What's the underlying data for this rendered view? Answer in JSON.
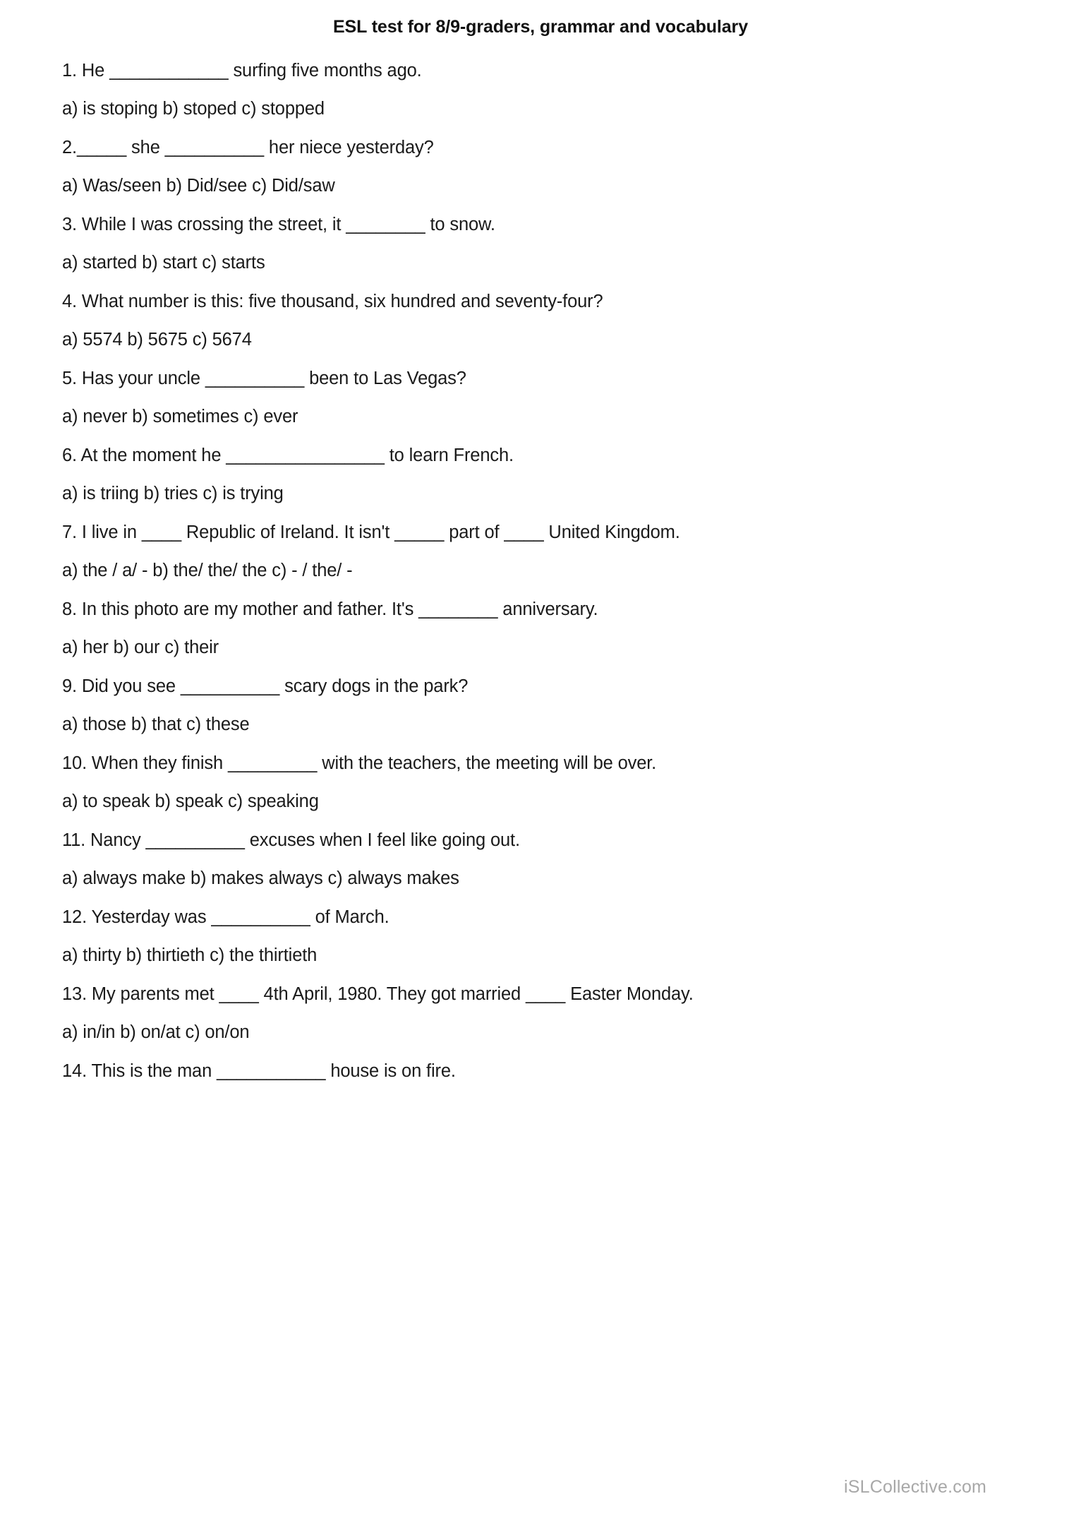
{
  "document": {
    "title": "ESL test for 8/9-graders, grammar and vocabulary",
    "watermark": "iSLCollective.com"
  },
  "questions": [
    {
      "number": "1.",
      "text": "1. He ____________ surfing five months ago.",
      "options_text": "a) is stoping          b) stoped          c) stopped",
      "options": [
        {
          "label": "a)",
          "value": "is stoping"
        },
        {
          "label": "b)",
          "value": "stoped"
        },
        {
          "label": "c)",
          "value": "stopped"
        }
      ]
    },
    {
      "number": "2.",
      "text": "2._____ she __________ her niece yesterday?",
      "options_text": "a) Was/seen          b) Did/see          c) Did/saw",
      "options": [
        {
          "label": "a)",
          "value": "Was/seen"
        },
        {
          "label": "b)",
          "value": "Did/see"
        },
        {
          "label": "c)",
          "value": "Did/saw"
        }
      ]
    },
    {
      "number": "3.",
      "text": "3. While I was crossing the street, it ________ to snow.",
      "options_text": "a) started          b) start          c) starts",
      "options": [
        {
          "label": "a)",
          "value": "started"
        },
        {
          "label": "b)",
          "value": "start"
        },
        {
          "label": "c)",
          "value": "starts"
        }
      ]
    },
    {
      "number": "4.",
      "text": "4. What number is this: five thousand, six hundred and seventy-four?",
      "options_text": "a) 5574          b) 5675          c) 5674",
      "options": [
        {
          "label": "a)",
          "value": "5574"
        },
        {
          "label": "b)",
          "value": "5675"
        },
        {
          "label": "c)",
          "value": "5674"
        }
      ]
    },
    {
      "number": "5.",
      "text": "5. Has your uncle __________ been to Las Vegas?",
      "options_text": "a) never          b) sometimes          c) ever",
      "options": [
        {
          "label": "a)",
          "value": "never"
        },
        {
          "label": "b)",
          "value": "sometimes"
        },
        {
          "label": "c)",
          "value": "ever"
        }
      ]
    },
    {
      "number": "6.",
      "text": "6. At the moment he ________________ to learn French.",
      "options_text": "a) is triing          b) tries          c) is trying",
      "options": [
        {
          "label": "a)",
          "value": "is triing"
        },
        {
          "label": "b)",
          "value": "tries"
        },
        {
          "label": "c)",
          "value": "is trying"
        }
      ]
    },
    {
      "number": "7.",
      "text": "7. I live in ____ Republic of Ireland. It isn't _____ part of ____ United Kingdom.",
      "options_text": "a)  the / a/ -          b) the/ the/ the     c) - / the/ -",
      "options": [
        {
          "label": "a)",
          "value": " the / a/ -"
        },
        {
          "label": "b)",
          "value": "the/ the/ the"
        },
        {
          "label": "c)",
          "value": "- / the/ -"
        }
      ]
    },
    {
      "number": "8.",
      "text": "8. In this photo are my mother and father. It's ________ anniversary.",
      "options_text": "a) her          b) our          c) their",
      "options": [
        {
          "label": "a)",
          "value": "her"
        },
        {
          "label": "b)",
          "value": "our"
        },
        {
          "label": "c)",
          "value": "their"
        }
      ]
    },
    {
      "number": "9.",
      "text": "9. Did you see __________ scary dogs in the park?",
      "options_text": "a) those          b) that          c) these",
      "options": [
        {
          "label": "a)",
          "value": "those"
        },
        {
          "label": "b)",
          "value": "that"
        },
        {
          "label": "c)",
          "value": "these"
        }
      ]
    },
    {
      "number": "10.",
      "text": "10. When they finish _________ with the teachers, the meeting will be over.",
      "options_text": "a) to speak     b) speak          c) speaking",
      "options": [
        {
          "label": "a)",
          "value": "to speak"
        },
        {
          "label": "b)",
          "value": "speak"
        },
        {
          "label": "c)",
          "value": "speaking"
        }
      ]
    },
    {
      "number": "11.",
      "text": "11. Nancy __________ excuses when I feel like going out.",
      "options_text": "a) always make     b) makes always     c) always makes",
      "options": [
        {
          "label": "a)",
          "value": "always make"
        },
        {
          "label": "b)",
          "value": "makes always"
        },
        {
          "label": "c)",
          "value": "always makes"
        }
      ]
    },
    {
      "number": "12.",
      "text": "12. Yesterday was __________ of March.",
      "options_text": "a) thirty          b) thirtieth          c) the thirtieth",
      "options": [
        {
          "label": "a)",
          "value": "thirty"
        },
        {
          "label": "b)",
          "value": "thirtieth"
        },
        {
          "label": "c)",
          "value": "the thirtieth"
        }
      ]
    },
    {
      "number": "13.",
      "text": "13. My parents met ____ 4th April, 1980. They got married ____ Easter Monday.",
      "options_text": "a) in/in          b) on/at          c) on/on",
      "options": [
        {
          "label": "a)",
          "value": "in/in"
        },
        {
          "label": "b)",
          "value": "on/at"
        },
        {
          "label": "c)",
          "value": "on/on"
        }
      ]
    },
    {
      "number": "14.",
      "text": "14. This is the man ___________ house is on fire.",
      "options_text": "",
      "options": []
    }
  ]
}
